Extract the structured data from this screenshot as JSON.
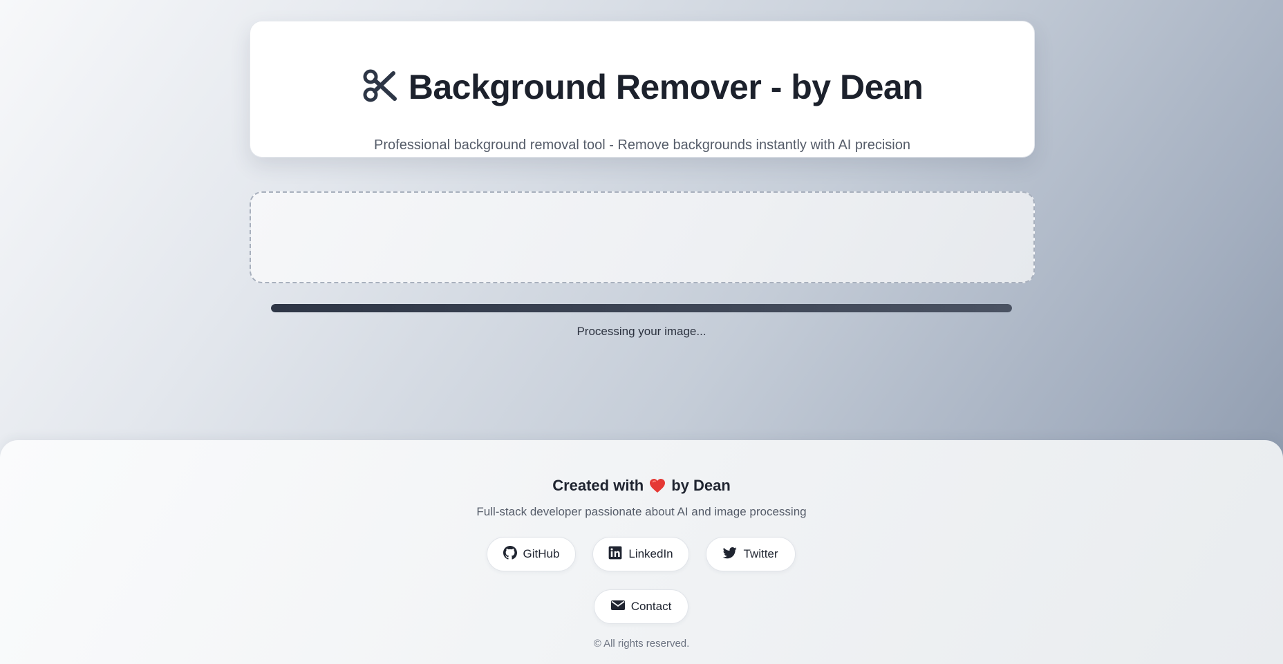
{
  "header": {
    "title": "Background Remover - by Dean",
    "subtitle": "Professional background removal tool - Remove backgrounds instantly with AI precision",
    "icon": "scissors-icon"
  },
  "upload": {
    "state": "processing"
  },
  "progress": {
    "fraction": 1.0,
    "label": "Processing your image..."
  },
  "footer": {
    "created_prefix": "Created with",
    "created_suffix": "by Dean",
    "heart_icon": "heart-icon",
    "tagline": "Full-stack developer passionate about AI and image processing",
    "links": [
      {
        "label": "GitHub",
        "icon": "github-icon"
      },
      {
        "label": "LinkedIn",
        "icon": "linkedin-icon"
      },
      {
        "label": "Twitter",
        "icon": "twitter-icon"
      },
      {
        "label": "Contact",
        "icon": "mail-icon"
      }
    ],
    "copyright": "© All rights reserved."
  },
  "colors": {
    "primary_dark": "#2d3646",
    "heart": "#e53935",
    "text_muted": "#555c69"
  }
}
